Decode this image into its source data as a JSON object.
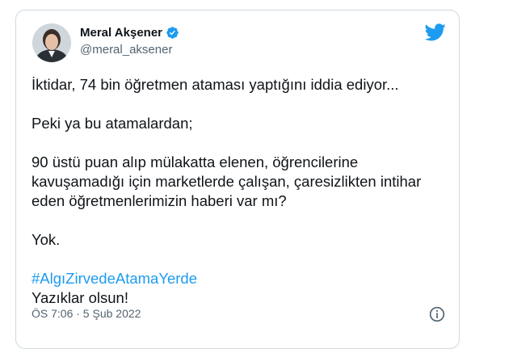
{
  "user": {
    "display_name": "Meral Akşener",
    "handle": "@meral_aksener",
    "avatar_icon": "profile-photo",
    "verified_icon": "verified-badge-icon"
  },
  "tweet": {
    "paragraphs": [
      "İktidar, 74 bin öğretmen ataması yaptığını iddia ediyor...",
      "Peki ya bu atamalardan;",
      "90 üstü puan alıp mülakatta elenen, öğrencilerine kavuşamadığı için marketlerde çalışan, çaresizlikten intihar eden öğretmenlerimizin haberi var mı?",
      "Yok."
    ],
    "hashtag": "#AlgıZirvedeAtamaYerde",
    "closing": "Yazıklar olsun!",
    "timestamp": "ÖS 7:06 · 5 Şub 2022"
  },
  "colors": {
    "accent": "#1d9bf0",
    "text": "#0f1419",
    "muted": "#536471",
    "border": "#cfd9de"
  },
  "icons": {
    "brand": "twitter-bird-icon",
    "info": "info-icon"
  }
}
